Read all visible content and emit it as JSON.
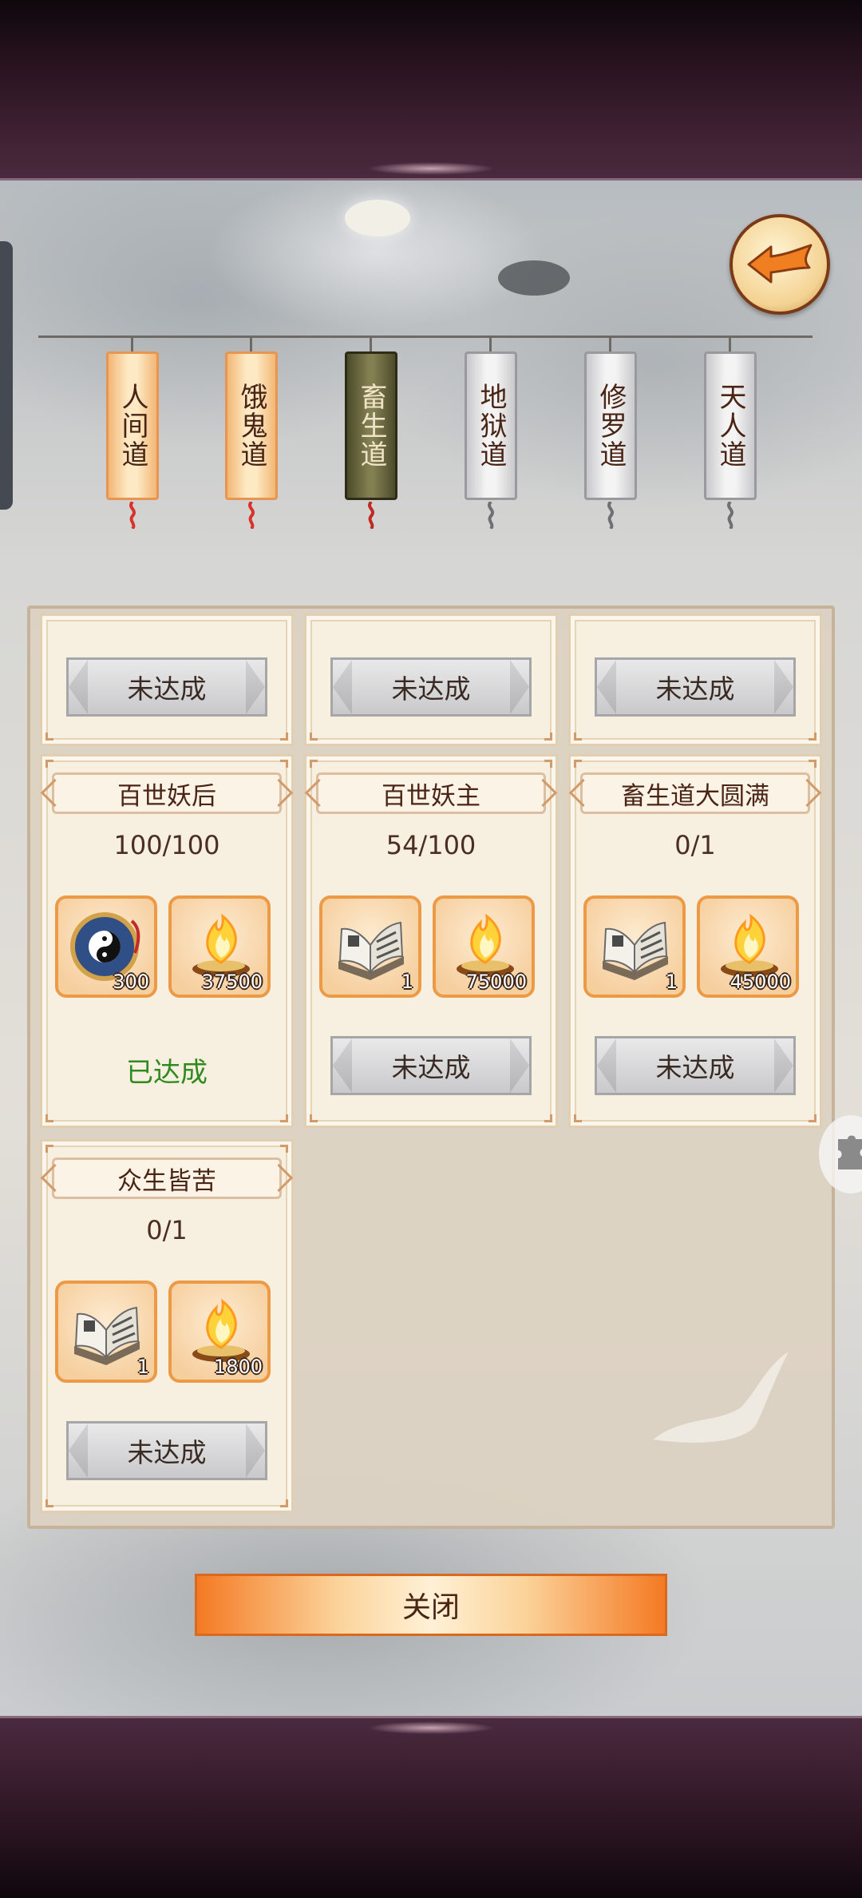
{
  "tabs": [
    {
      "label": "人间道",
      "state": "orange"
    },
    {
      "label": "饿鬼道",
      "state": "orange"
    },
    {
      "label": "畜生道",
      "state": "active"
    },
    {
      "label": "地狱道",
      "state": "grey"
    },
    {
      "label": "修罗道",
      "state": "grey"
    },
    {
      "label": "天人道",
      "state": "grey"
    }
  ],
  "top_row": [
    {
      "status": "未达成"
    },
    {
      "status": "未达成"
    },
    {
      "status": "未达成"
    }
  ],
  "cards": [
    {
      "title": "百世妖后",
      "progress": "100/100",
      "rewards": [
        {
          "icon": "bagua-compass-icon",
          "count": "300"
        },
        {
          "icon": "spirit-flame-icon",
          "count": "37500"
        }
      ],
      "status": "已达成"
    },
    {
      "title": "百世妖主",
      "progress": "54/100",
      "rewards": [
        {
          "icon": "scroll-book-icon",
          "count": "1"
        },
        {
          "icon": "spirit-flame-icon",
          "count": "75000"
        }
      ],
      "status": "未达成"
    },
    {
      "title": "畜生道大圆满",
      "progress": "0/1",
      "rewards": [
        {
          "icon": "scroll-book-icon",
          "count": "1"
        },
        {
          "icon": "spirit-flame-icon",
          "count": "45000"
        }
      ],
      "status": "未达成"
    },
    {
      "title": "众生皆苦",
      "progress": "0/1",
      "rewards": [
        {
          "icon": "scroll-book-icon",
          "count": "1"
        },
        {
          "icon": "spirit-flame-icon",
          "count": "1800"
        }
      ],
      "status": "未达成"
    }
  ],
  "close_label": "关闭",
  "colors": {
    "accent_orange": "#ec9a45",
    "done_green": "#2f8a1f",
    "text_brown": "#4a2415"
  }
}
